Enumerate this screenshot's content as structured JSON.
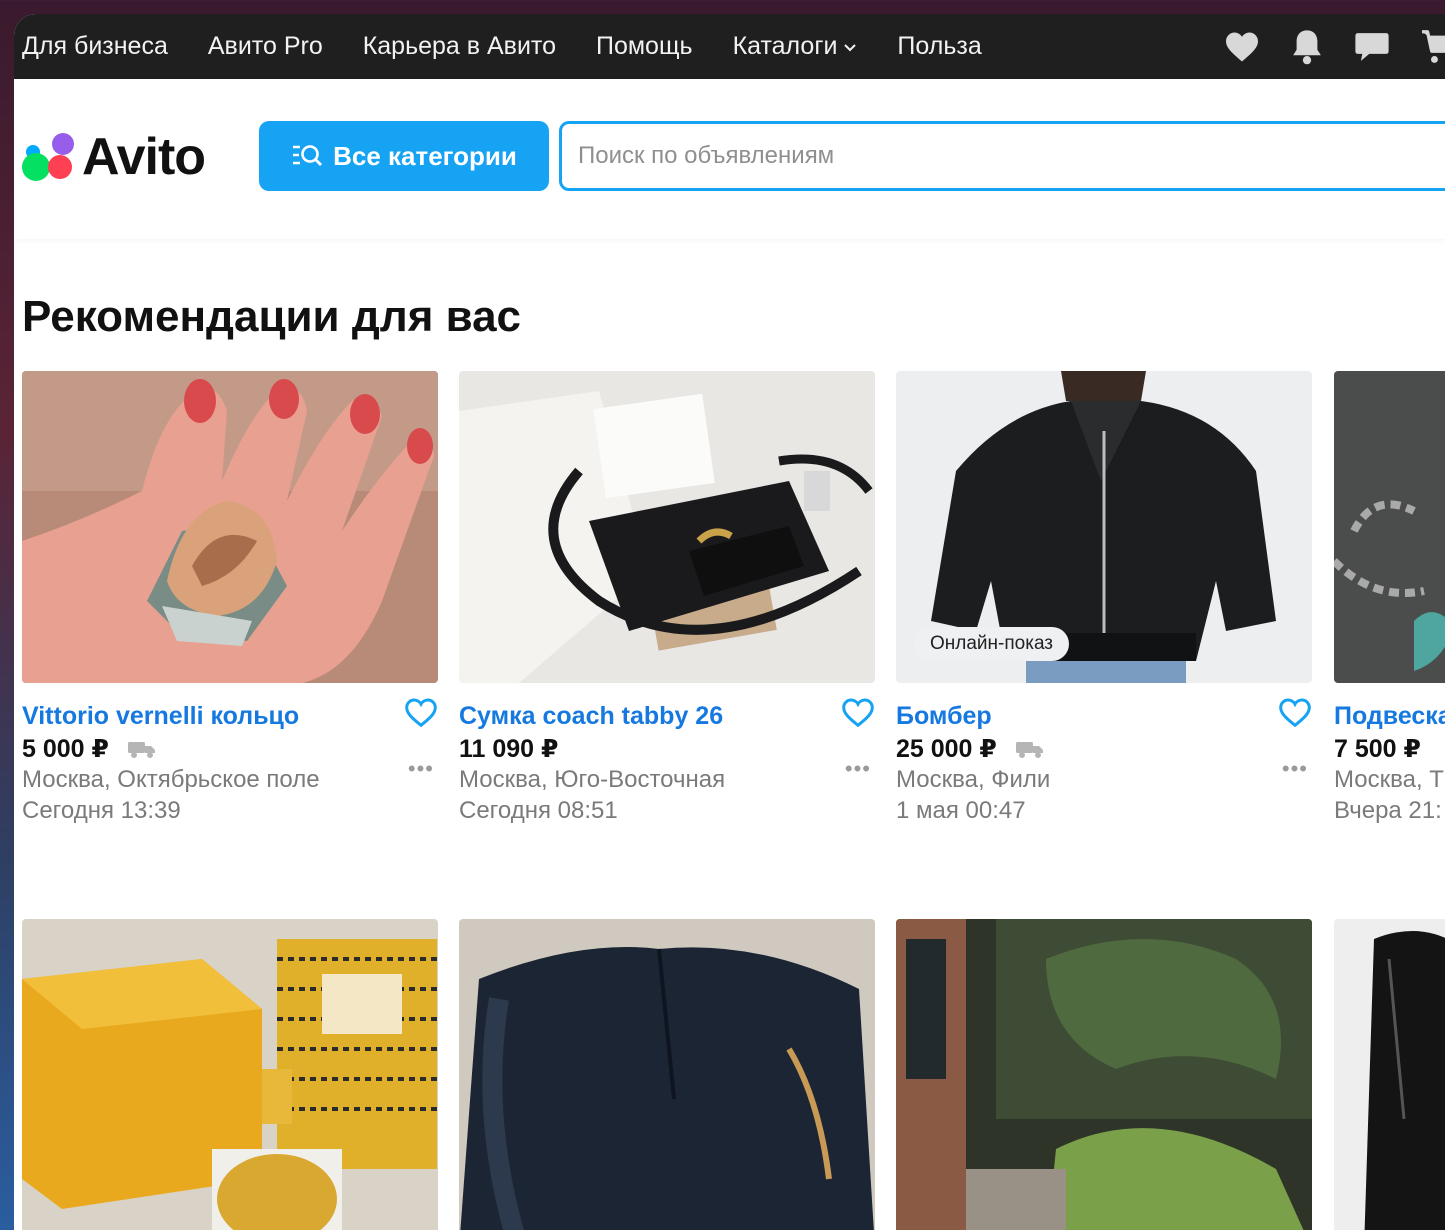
{
  "topbar": {
    "links": [
      "Для бизнеса",
      "Авито Pro",
      "Карьера в Авито",
      "Помощь",
      "Каталоги",
      "Польза"
    ],
    "icons": [
      "heart-icon",
      "bell-icon",
      "chat-icon",
      "cart-icon"
    ]
  },
  "header": {
    "logo_text": "Avito",
    "categories_label": "Все категории",
    "search_placeholder": "Поиск по объявлениям"
  },
  "section_title": "Рекомендации для вас",
  "colors": {
    "accent": "#16a3f4",
    "link": "#1679e0"
  },
  "cards": [
    {
      "title": "Vittorio vernelli кольцо",
      "price": "5 000 ₽",
      "location": "Москва, Октябрьское поле",
      "date": "Сегодня 13:39",
      "delivery": true
    },
    {
      "title": "Сумка coach tabby 26",
      "price": "11 090 ₽",
      "location": "Москва, Юго-Восточная",
      "date": "Сегодня 08:51",
      "delivery": false
    },
    {
      "title": "Бомбер",
      "price": "25 000 ₽",
      "location": "Москва, Фили",
      "date": "1 мая 00:47",
      "delivery": true,
      "badge": "Онлайн-показ"
    },
    {
      "title": "Подвеска браслет",
      "price": "7 500 ₽",
      "location": "Москва, Т",
      "date": "Вчера 21:",
      "delivery": true
    }
  ]
}
